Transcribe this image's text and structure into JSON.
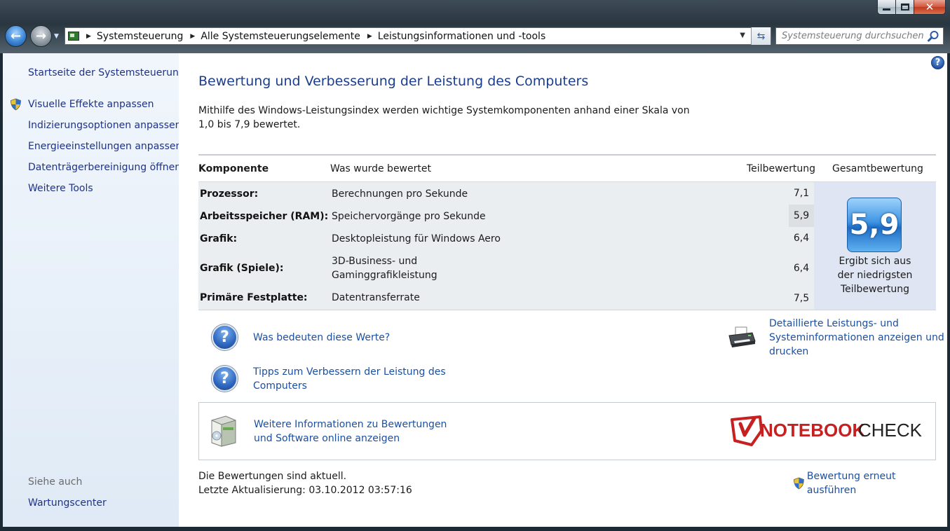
{
  "window": {
    "caption_buttons": {
      "minimize_icon": "minimize-icon",
      "maximize_icon": "maximize-icon",
      "close_icon": "close-icon",
      "close_glyph": "✕"
    }
  },
  "toolbar": {
    "back_glyph": "←",
    "forward_glyph": "→",
    "breadcrumb": [
      "Systemsteuerung",
      "Alle Systemsteuerungselemente",
      "Leistungsinformationen und -tools"
    ],
    "breadcrumb_separator": "▶",
    "dropdown_glyph": "▼",
    "refresh_glyph": "⇆",
    "search_placeholder": "Systemsteuerung durchsuchen"
  },
  "sidebar": {
    "home_link": "Startseite der Systemsteuerung",
    "tasks": [
      {
        "label": "Visuelle Effekte anpassen",
        "shield": true
      },
      {
        "label": "Indizierungsoptionen anpassen",
        "shield": false
      },
      {
        "label": "Energieeinstellungen anpassen",
        "shield": false
      },
      {
        "label": "Datenträgerbereinigung öffnen",
        "shield": false
      },
      {
        "label": "Weitere Tools",
        "shield": false
      }
    ],
    "see_also_heading": "Siehe auch",
    "see_also": [
      "Wartungscenter"
    ]
  },
  "main": {
    "help_glyph": "?",
    "title": "Bewertung und Verbesserung der Leistung des Computers",
    "intro": "Mithilfe des Windows-Leistungsindex werden wichtige Systemkomponenten anhand einer Skala von 1,0 bis 7,9 bewertet.",
    "table": {
      "headers": {
        "component": "Komponente",
        "rated": "Was wurde bewertet",
        "subscore": "Teilbewertung",
        "basescore": "Gesamtbewertung"
      },
      "rows": [
        {
          "component": "Prozessor:",
          "rated": "Berechnungen pro Sekunde",
          "subscore": "7,1"
        },
        {
          "component": "Arbeitsspeicher (RAM):",
          "rated": "Speichervorgänge pro Sekunde",
          "subscore": "5,9"
        },
        {
          "component": "Grafik:",
          "rated": "Desktopleistung für Windows Aero",
          "subscore": "6,4"
        },
        {
          "component": "Grafik (Spiele):",
          "rated": "3D-Business- und Gaminggrafikleistung",
          "rated_line1": "3D-Business- und",
          "rated_line2": "Gaminggrafikleistung",
          "subscore": "6,4"
        },
        {
          "component": "Primäre Festplatte:",
          "rated": "Datentransferrate",
          "subscore": "7,5"
        }
      ],
      "base_score": "5,9",
      "base_caption_line1": "Ergibt sich aus",
      "base_caption_line2": "der niedrigsten",
      "base_caption_line3": "Teilbewertung"
    },
    "links": {
      "what_mean": "Was bedeuten diese Werte?",
      "tips_line1": "Tipps zum Verbessern der Leistung des",
      "tips_line2": "Computers",
      "details_line1": "Detaillierte Leistungs- und",
      "details_line2": "Systeminformationen anzeigen und",
      "details_line3": "drucken",
      "online_line1": "Weitere Informationen zu Bewertungen",
      "online_line2": "und Software online anzeigen",
      "question_glyph": "?"
    },
    "watermark": {
      "part1": "NOTEBOOK",
      "part2": "CHECK",
      "color_red": "#d0231f"
    },
    "status": {
      "line1": "Die Bewertungen sind aktuell.",
      "line2": "Letzte Aktualisierung: 03.10.2012 03:57:16",
      "rerun": "Bewertung erneut ausführen"
    }
  }
}
